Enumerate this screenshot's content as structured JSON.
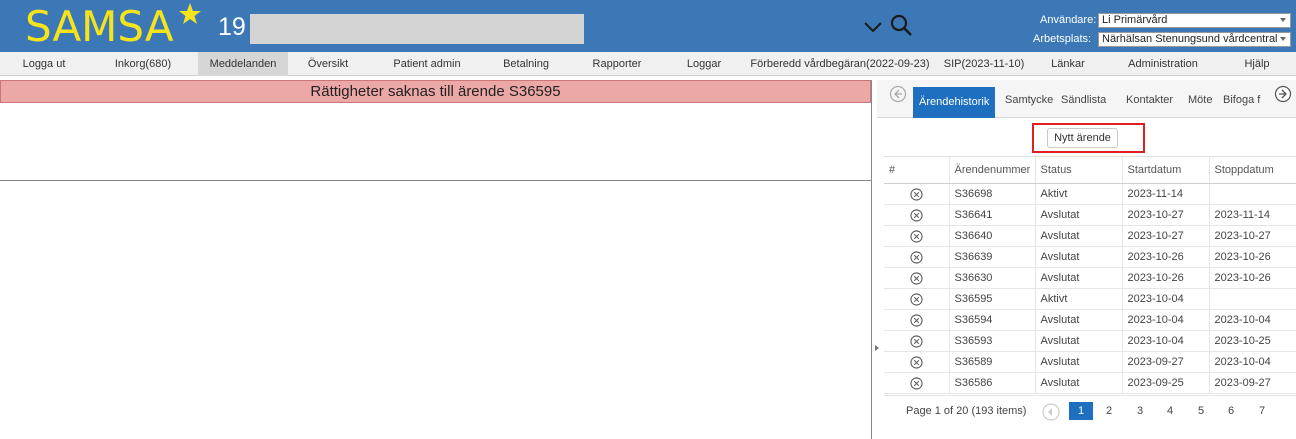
{
  "header": {
    "logo": "SAMSA",
    "patient_number": "19",
    "user_label": "Användare:",
    "user_value": "Li Primärvård",
    "place_label": "Arbetsplats:",
    "place_value": "Närhälsan Stenungsund vårdcentral",
    "colors": {
      "bar": "#3b78b5",
      "logo": "#f5e31c"
    }
  },
  "nav": [
    {
      "label": "Logga ut"
    },
    {
      "label": "Inkorg(680)"
    },
    {
      "label": "Meddelanden",
      "active": true
    },
    {
      "label": "Översikt"
    },
    {
      "label": "Patient admin"
    },
    {
      "label": "Betalning"
    },
    {
      "label": "Rapporter"
    },
    {
      "label": "Loggar"
    },
    {
      "label": "Förberedd vårdbegäran(2022-09-23)"
    },
    {
      "label": "SIP(2023-11-10)"
    },
    {
      "label": "Länkar"
    },
    {
      "label": "Administration"
    },
    {
      "label": "Hjälp"
    }
  ],
  "alert": {
    "text": "Rättigheter saknas till ärende S36595",
    "color": "#eca7a7"
  },
  "tabs": [
    {
      "label": "Ärendehistorik",
      "active": true
    },
    {
      "label": "Samtycke"
    },
    {
      "label": "Sändlista"
    },
    {
      "label": "Kontakter"
    },
    {
      "label": "Möte"
    },
    {
      "label": "Bifoga f"
    }
  ],
  "new_case_button": "Nytt ärende",
  "table": {
    "headers": [
      "#",
      "Ärendenummer",
      "Status",
      "Startdatum",
      "Stoppdatum"
    ],
    "rows": [
      {
        "nr": "S36698",
        "status": "Aktivt",
        "start": "2023-11-14",
        "stop": ""
      },
      {
        "nr": "S36641",
        "status": "Avslutat",
        "start": "2023-10-27",
        "stop": "2023-11-14"
      },
      {
        "nr": "S36640",
        "status": "Avslutat",
        "start": "2023-10-27",
        "stop": "2023-10-27"
      },
      {
        "nr": "S36639",
        "status": "Avslutat",
        "start": "2023-10-26",
        "stop": "2023-10-26"
      },
      {
        "nr": "S36630",
        "status": "Avslutat",
        "start": "2023-10-26",
        "stop": "2023-10-26"
      },
      {
        "nr": "S36595",
        "status": "Aktivt",
        "start": "2023-10-04",
        "stop": ""
      },
      {
        "nr": "S36594",
        "status": "Avslutat",
        "start": "2023-10-04",
        "stop": "2023-10-04"
      },
      {
        "nr": "S36593",
        "status": "Avslutat",
        "start": "2023-10-04",
        "stop": "2023-10-25"
      },
      {
        "nr": "S36589",
        "status": "Avslutat",
        "start": "2023-09-27",
        "stop": "2023-10-04"
      },
      {
        "nr": "S36586",
        "status": "Avslutat",
        "start": "2023-09-25",
        "stop": "2023-09-27"
      }
    ]
  },
  "pager": {
    "summary": "Page 1 of 20 (193 items)",
    "pages": [
      "1",
      "2",
      "3",
      "4",
      "5",
      "6",
      "7"
    ],
    "current": "1"
  }
}
